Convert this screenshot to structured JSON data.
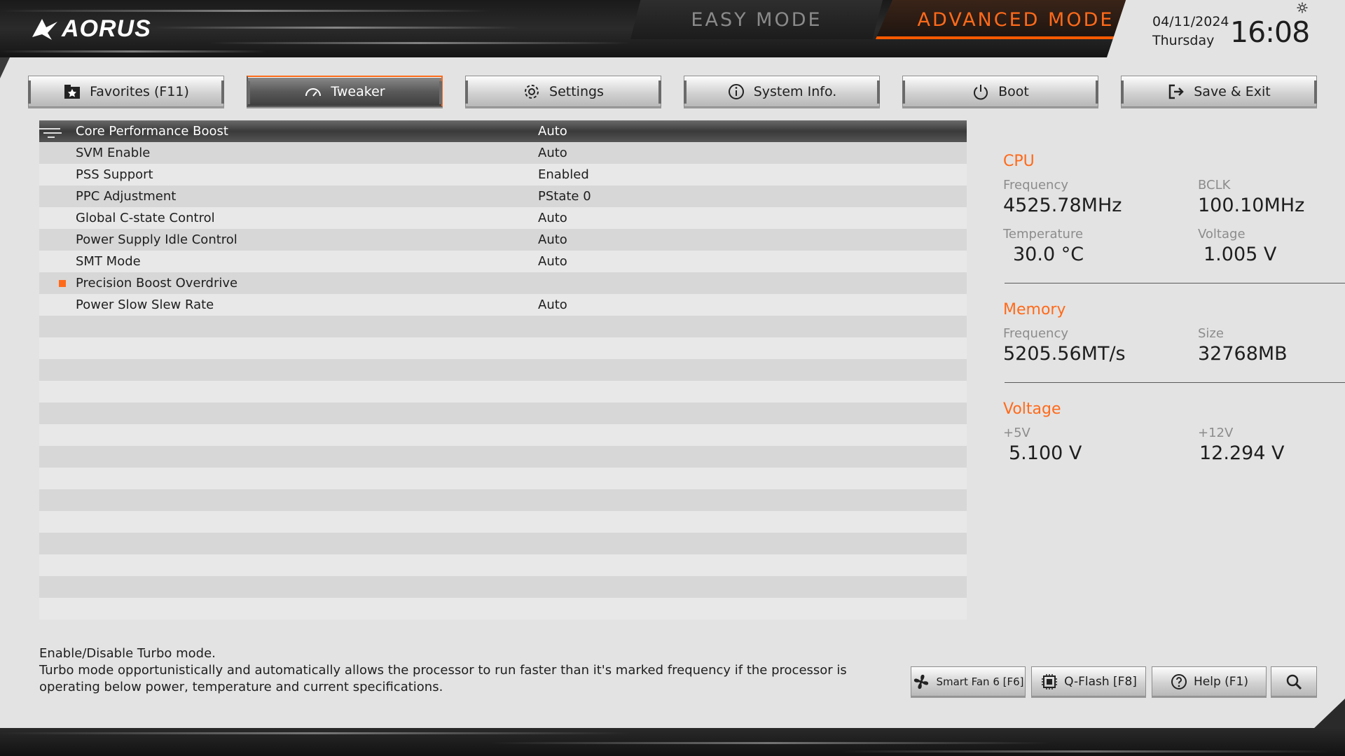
{
  "header": {
    "brand": "AORUS",
    "easy_mode_label": "EASY MODE",
    "advanced_mode_label": "ADVANCED MODE",
    "date": "04/11/2024",
    "day": "Thursday",
    "time": "16:08"
  },
  "tabs": [
    {
      "label": "Favorites (F11)",
      "icon": "star-folder-icon"
    },
    {
      "label": "Tweaker",
      "icon": "speedometer-icon",
      "active": true
    },
    {
      "label": "Settings",
      "icon": "gear-icon"
    },
    {
      "label": "System Info.",
      "icon": "info-icon"
    },
    {
      "label": "Boot",
      "icon": "power-icon"
    },
    {
      "label": "Save & Exit",
      "icon": "exit-icon"
    }
  ],
  "settings": [
    {
      "label": "Core Performance Boost",
      "value": "Auto"
    },
    {
      "label": "SVM Enable",
      "value": "Auto"
    },
    {
      "label": "PSS Support",
      "value": "Enabled"
    },
    {
      "label": "PPC Adjustment",
      "value": "PState 0"
    },
    {
      "label": "Global C-state Control",
      "value": "Auto"
    },
    {
      "label": "Power Supply Idle Control",
      "value": "Auto"
    },
    {
      "label": "SMT Mode",
      "value": "Auto"
    },
    {
      "label": "Precision Boost Overdrive",
      "value": ""
    },
    {
      "label": "Power Slow Slew Rate",
      "value": "Auto"
    }
  ],
  "info": {
    "cpu": {
      "title": "CPU",
      "frequency_label": "Frequency",
      "frequency": "4525.78MHz",
      "bclk_label": "BCLK",
      "bclk": "100.10MHz",
      "temperature_label": "Temperature",
      "temperature": "30.0 °C",
      "voltage_label": "Voltage",
      "voltage": "1.005 V"
    },
    "memory": {
      "title": "Memory",
      "frequency_label": "Frequency",
      "frequency": "5205.56MT/s",
      "size_label": "Size",
      "size": "32768MB"
    },
    "voltage": {
      "title": "Voltage",
      "v5_label": "+5V",
      "v5": "5.100 V",
      "v12_label": "+12V",
      "v12": "12.294 V"
    }
  },
  "help": {
    "line1": "Enable/Disable Turbo mode.",
    "line2": "Turbo mode opportunistically and automatically allows the processor to run faster than it's marked frequency if the processor is operating below power, temperature and current specifications."
  },
  "bottom_buttons": {
    "smart_fan": "Smart Fan 6 [F6]",
    "qflash": "Q-Flash [F8]",
    "help": "Help (F1)"
  },
  "colors": {
    "accent": "#ff6a1a",
    "background": "#e3e3e3"
  }
}
